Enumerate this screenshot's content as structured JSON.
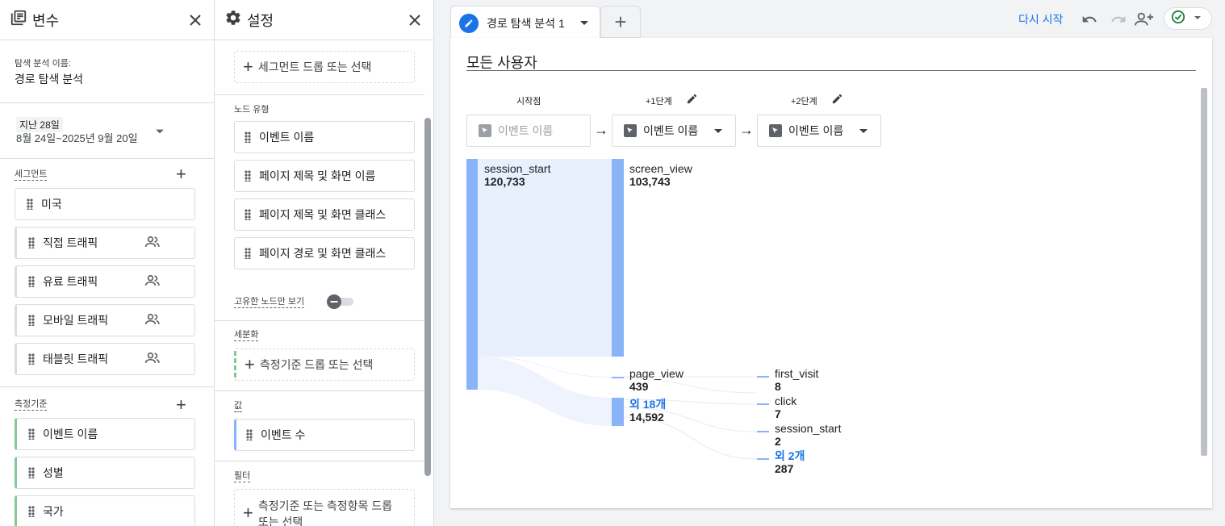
{
  "variables": {
    "title": "변수",
    "exploration_name_label": "탐색 분석 이름:",
    "exploration_name": "경로 탐색 분석",
    "date_preset": "지난 28일",
    "date_range": "8월 24일~2025년 9월 20일",
    "segments_label": "세그먼트",
    "segments": [
      "미국",
      "직접 트래픽",
      "유료 트래픽",
      "모바일 트래픽",
      "태블릿 트래픽"
    ],
    "dimensions_label": "측정기준",
    "dimensions": [
      "이벤트 이름",
      "성별",
      "국가"
    ]
  },
  "settings": {
    "title": "설정",
    "segment_drop": "세그먼트 드롭 또는 선택",
    "node_type_label": "노드 유형",
    "node_types": [
      "이벤트 이름",
      "페이지 제목 및 화면 이름",
      "페이지 제목 및 화면 클래스",
      "페이지 경로 및 화면 클래스"
    ],
    "unique_nodes_label": "고유한 노드만 보기",
    "breakdown_label": "세분화",
    "breakdown_drop": "측정기준 드롭 또는 선택",
    "values_label": "값",
    "value_chip": "이벤트 수",
    "filter_label": "필터",
    "filter_drop_line1": "측정기준 또는 측정항목 드롭",
    "filter_drop_line2": "또는 선택"
  },
  "main": {
    "tab_label": "경로 탐색 분석 1",
    "restart_label": "다시 시작",
    "segment_title": "모든 사용자",
    "steps": [
      {
        "label": "시작점",
        "box": "이벤트 이름"
      },
      {
        "label": "+1단계",
        "box": "이벤트 이름"
      },
      {
        "label": "+2단계",
        "box": "이벤트 이름"
      }
    ],
    "nodes": {
      "start": {
        "name": "session_start",
        "value": "120,733"
      },
      "step1": [
        {
          "name": "screen_view",
          "value": "103,743"
        },
        {
          "name": "page_view",
          "value": "439"
        },
        {
          "name": "외 18개",
          "value": "14,592"
        }
      ],
      "step2": [
        {
          "name": "first_visit",
          "value": "8"
        },
        {
          "name": "click",
          "value": "7"
        },
        {
          "name": "session_start",
          "value": "2"
        },
        {
          "name": "외 2개",
          "value": "287"
        }
      ]
    },
    "colors": {
      "node": "#8ab4f8",
      "flow": "#e8f0fe",
      "accent": "#1a73e8",
      "link": "#1a73e8"
    }
  }
}
